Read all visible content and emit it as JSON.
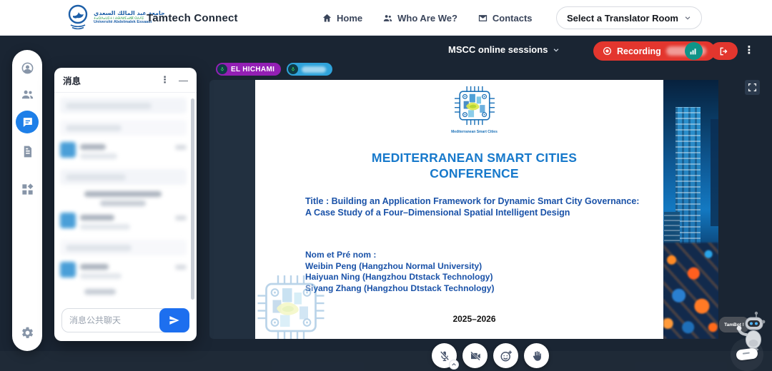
{
  "header": {
    "logo": {
      "arabic_name": "جامعة عبد المالك السعدي",
      "amazigh_name": "ⵜⴰⵙⴷⴰⵡⵉⵜ ⵏ ⵄⴱⴷⵍⵎⴰⵍⴽ ⵙⵄⴷⵉ",
      "french_name": "Université Abdelmalek Essaadi"
    },
    "brand": "Tamtech Connect",
    "nav": {
      "home": "Home",
      "who": "Who Are We?",
      "contacts": "Contacts"
    },
    "room_selector_label": "Select a Translator Room"
  },
  "session": {
    "title": "MSCC online sessions",
    "recording_label": "Recording"
  },
  "speakers": {
    "speaker1": "EL HICHAMI"
  },
  "chat_panel": {
    "title": "消息",
    "menu_icon": "⋮",
    "minimize_icon": "—",
    "input_placeholder": "消息公共聊天"
  },
  "slide": {
    "logo_caption": "Mediterranean Smart Cities",
    "title_line1": "MEDITERRANEAN SMART CITIES",
    "title_line2": "CONFERENCE",
    "subtitle": "Title : Building an Application Framework for Dynamic Smart City Governance: A Case Study of a Four–Dimensional Spatial Intelligent Design",
    "authors_label": "Nom et Pré nom :",
    "authors": [
      "Weibin Peng (Hangzhou Normal University)",
      "Haiyuan Ning (Hangzhou Dtstack Technology)",
      "Siyang Zhang (Hangzhou Dtstack Technology)"
    ],
    "years": "2025–2026"
  },
  "bot": {
    "bubble_text": "TamBot !"
  },
  "menu_icon": "⋮",
  "colors": {
    "page_bg": "#1A2533",
    "accent_blue": "#1E7FE8",
    "recording_red": "#E3362E",
    "stats_teal": "#0E9488",
    "speaker_purple": "#931FB4",
    "speaker_blue": "#2FA3DB",
    "slide_title_blue": "#1779CB",
    "slide_text_blue": "#1A52A8",
    "send_blue": "#1D6FEF"
  }
}
